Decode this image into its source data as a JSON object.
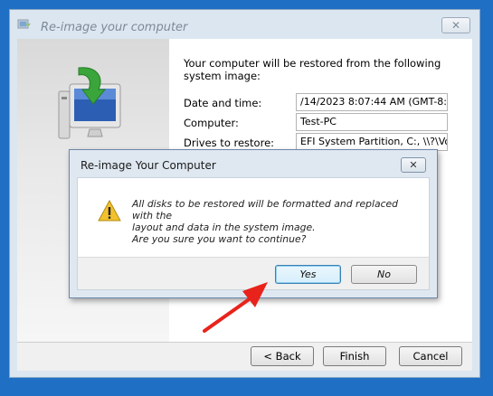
{
  "window": {
    "title": "Re-image your computer",
    "close_glyph": "✕"
  },
  "restore": {
    "intro": "Your computer will be restored from the following system image:",
    "fields": [
      {
        "label": "Date and time:",
        "value": "/14/2023 8:07:44 AM (GMT-8:00)"
      },
      {
        "label": "Computer:",
        "value": "Test-PC"
      },
      {
        "label": "Drives to restore:",
        "value": "EFI System Partition, C:, \\\\?\\Volur"
      }
    ]
  },
  "footer": {
    "back_label": "< Back",
    "finish_label": "Finish",
    "cancel_label": "Cancel"
  },
  "modal": {
    "title": "Re-image Your Computer",
    "close_glyph": "✕",
    "message_lines": [
      "All disks to be restored will be formatted and replaced with the",
      "layout and data in the system image.",
      "Are you sure you want to continue?"
    ],
    "yes_label": "Yes",
    "no_label": "No",
    "icon": "warning-icon"
  },
  "icons": {
    "window_icon": "restore-window-icon",
    "computer": "computer-restore-icon",
    "annotation": "red-arrow-icon"
  },
  "colors": {
    "desktop": "#1f6fc4",
    "warning": "#f2c12e",
    "arrow": "#e8231b",
    "accent_green": "#3aa53a"
  }
}
